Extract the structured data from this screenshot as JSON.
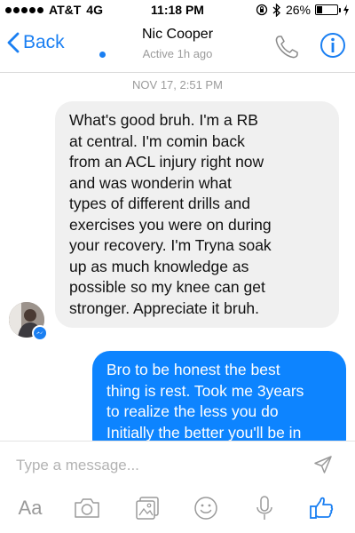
{
  "status_bar": {
    "carrier": "AT&T",
    "network": "4G",
    "time": "11:18 PM",
    "battery_percent": "26%",
    "battery_level": 0.26,
    "signal_bars_filled": 5
  },
  "nav": {
    "back_label": "Back",
    "contact_name": "Nic Cooper",
    "contact_status": "Active 1h ago",
    "icons": [
      "chevron-left-icon",
      "phone-icon",
      "info-icon"
    ]
  },
  "conversation": {
    "timestamp": "NOV 17, 2:51 PM",
    "messages": [
      {
        "direction": "incoming",
        "text": "What's good bruh. I'm a RB\nat central. I'm comin back\nfrom an ACL injury right now\nand was wonderin what\ntypes of different drills and\nexercises you were on during\nyour recovery. I'm Tryna soak\nup as much knowledge as\npossible so my knee can get\nstronger. Appreciate it bruh."
      },
      {
        "direction": "outgoing",
        "text": "Bro to be honest the best\nthing is rest. Took me 3years\nto realize the less you do\nInitially the better you'll be in"
      }
    ]
  },
  "composer": {
    "placeholder": "Type a message...",
    "aa_label": "Aa",
    "tools": [
      "text-format-icon",
      "camera-icon",
      "photo-icon",
      "emoji-icon",
      "microphone-icon",
      "thumbs-up-icon"
    ]
  },
  "colors": {
    "accent": "#1a7ff2",
    "outgoing_bubble": "#0d84ff",
    "incoming_bubble": "#f0f0f0",
    "muted_text": "#9b9b9b"
  }
}
